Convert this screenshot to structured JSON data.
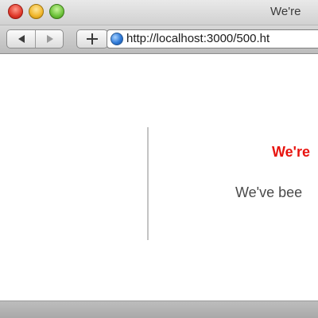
{
  "window": {
    "title": "We're"
  },
  "toolbar": {
    "url": "http://localhost:3000/500.ht"
  },
  "page": {
    "heading": "We're",
    "message": "We've bee"
  },
  "colors": {
    "heading": "#e8140f",
    "body_text": "#4a4a4a",
    "divider": "#c4c4c4"
  },
  "icons": {
    "back": "back-arrow-icon",
    "forward": "forward-arrow-icon",
    "add": "plus-icon",
    "site": "globe-icon"
  }
}
